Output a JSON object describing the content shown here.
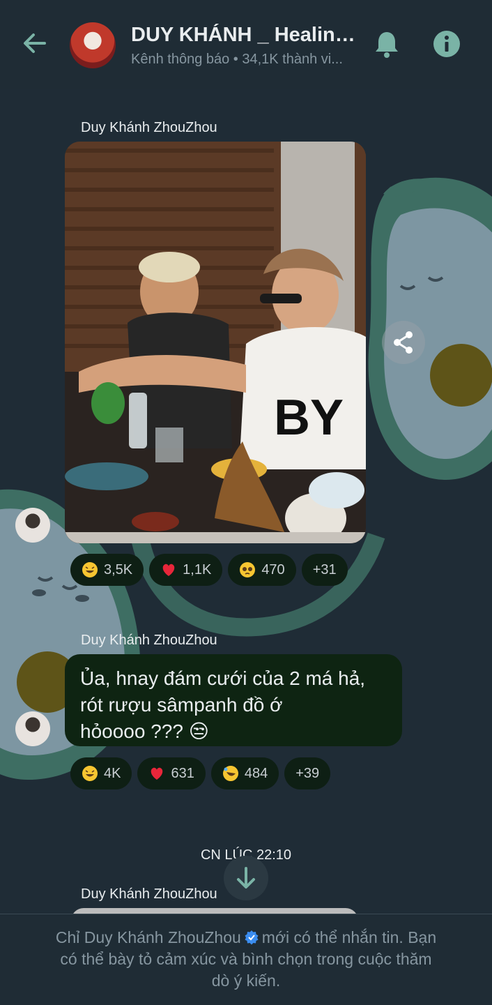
{
  "header": {
    "title": "DUY KHÁNH _ Healing ...",
    "subtitle": "Kênh thông báo • 34,1K thành vi..."
  },
  "messages": [
    {
      "sender": "Duy Khánh ZhouZhou",
      "type": "photo",
      "reactions": [
        {
          "emoji": "grin-sweat-icon",
          "count": "3,5K"
        },
        {
          "emoji": "heart-icon",
          "count": "1,1K"
        },
        {
          "emoji": "pleading-face-icon",
          "count": "470"
        },
        {
          "emoji": "",
          "count": "+31"
        }
      ]
    },
    {
      "sender": "Duy Khánh ZhouZhou",
      "type": "text",
      "text_lines": [
        "Ủa, hnay đám cưới của 2 má hả,",
        "rót rượu sâmpanh đồ ớ",
        "hỏoooo ??? 😒"
      ],
      "reactions": [
        {
          "emoji": "grin-sweat-icon",
          "count": "4K"
        },
        {
          "emoji": "heart-icon",
          "count": "631"
        },
        {
          "emoji": "rofl-icon",
          "count": "484"
        },
        {
          "emoji": "",
          "count": "+39"
        }
      ]
    }
  ],
  "date_separator": "CN LÚC 22:10",
  "next_sender": "Duy Khánh ZhouZhou",
  "footer": {
    "before_name": "Chỉ Duy Khánh ZhouZhou",
    "after_name": "mới có thể nhắn tin. Bạn",
    "line2": "có thể bày tỏ cảm xúc và bình chọn trong cuộc thăm",
    "line3": "dò ý kiến."
  },
  "colors": {
    "background": "#1f2c36",
    "bubble": "#0e2412",
    "accent": "#7ab3a6",
    "muted_text": "#8696a0"
  }
}
